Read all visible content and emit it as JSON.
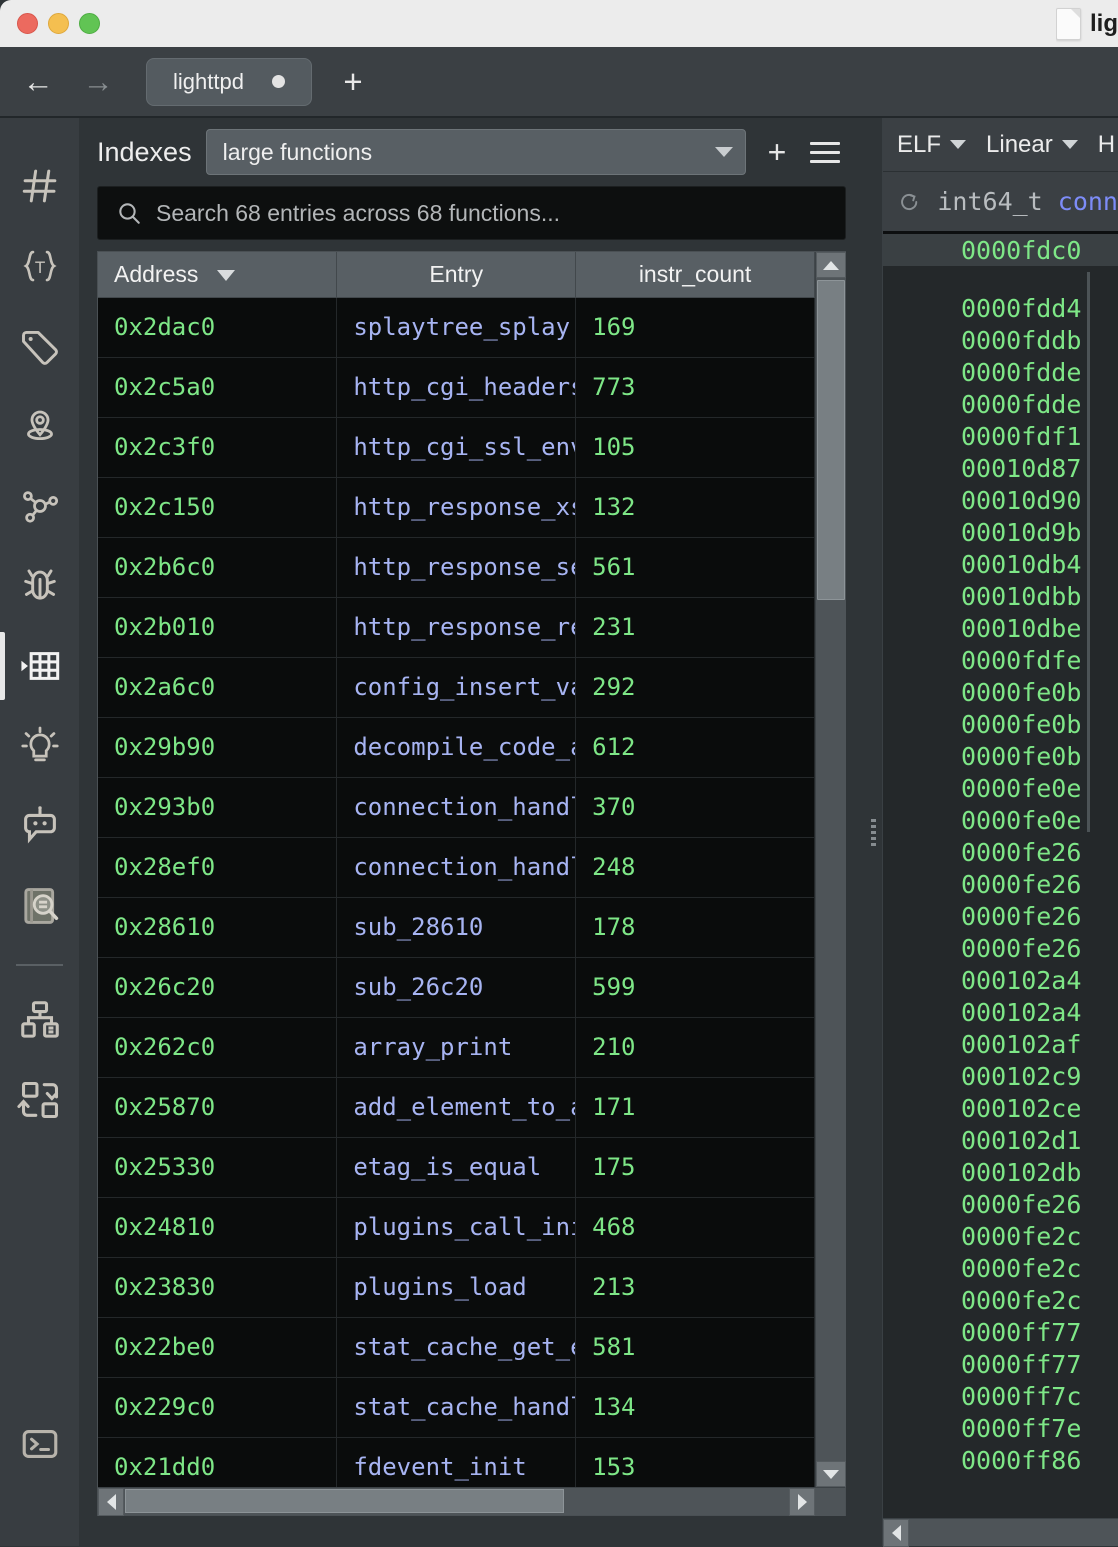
{
  "window": {
    "title": "lig",
    "doc_icon": "document-icon",
    "traffic_lights": [
      "close",
      "minimize",
      "maximize"
    ]
  },
  "tabbar": {
    "back_icon": "arrow-left-icon",
    "forward_icon": "arrow-right-icon",
    "new_tab_icon": "plus-icon",
    "tabs": [
      {
        "label": "lighttpd",
        "modified": true
      }
    ]
  },
  "sidebar": {
    "items": [
      {
        "name": "hash-icon",
        "label": "Symbols",
        "active": false
      },
      {
        "name": "types-icon",
        "label": "Types",
        "active": false
      },
      {
        "name": "tag-icon",
        "label": "Tags",
        "active": false
      },
      {
        "name": "location-pin-icon",
        "label": "Bookmarks",
        "active": false
      },
      {
        "name": "graph-nodes-icon",
        "label": "Call Graph",
        "active": false
      },
      {
        "name": "bug-icon",
        "label": "Debugger",
        "active": false
      },
      {
        "name": "table-grid-icon",
        "label": "Indexes",
        "active": true
      },
      {
        "name": "lightbulb-icon",
        "label": "Insights",
        "active": false
      },
      {
        "name": "robot-chat-icon",
        "label": "Assistant",
        "active": false
      },
      {
        "name": "notebook-search-icon",
        "label": "Notebook Search",
        "active": false
      },
      {
        "name": "hierarchy-icon",
        "label": "Hierarchy",
        "active": false
      },
      {
        "name": "cross-reference-icon",
        "label": "Cross References",
        "active": false
      }
    ],
    "bottom_item": {
      "name": "terminal-icon",
      "label": "Terminal"
    }
  },
  "indexes": {
    "title": "Indexes",
    "selected_index": "large functions",
    "add_label": "+",
    "menu_icon": "hamburger-menu-icon",
    "search": {
      "icon": "search-icon",
      "placeholder": "Search 68 entries across 68 functions...",
      "value": ""
    },
    "columns": [
      {
        "key": "address",
        "label": "Address",
        "sorted": "desc"
      },
      {
        "key": "entry",
        "label": "Entry",
        "sorted": "none"
      },
      {
        "key": "instr_count",
        "label": "instr_count",
        "sorted": "none"
      }
    ],
    "rows": [
      {
        "address": "0x2dac0",
        "entry": "splaytree_splay",
        "instr_count": "169"
      },
      {
        "address": "0x2c5a0",
        "entry": "http_cgi_headers",
        "instr_count": "773"
      },
      {
        "address": "0x2c3f0",
        "entry": "http_cgi_ssl_env",
        "instr_count": "105"
      },
      {
        "address": "0x2c150",
        "entry": "http_response_xsendfile",
        "instr_count": "132"
      },
      {
        "address": "0x2b6c0",
        "entry": "http_response_send_file",
        "instr_count": "561"
      },
      {
        "address": "0x2b010",
        "entry": "http_response_redirect_to_dir",
        "instr_count": "231"
      },
      {
        "address": "0x2a6c0",
        "entry": "config_insert_values_internal",
        "instr_count": "292"
      },
      {
        "address": "0x29b90",
        "entry": "decompile_code_analyze",
        "instr_count": "612"
      },
      {
        "address": "0x293b0",
        "entry": "connection_handle_read_post_state",
        "instr_count": "370"
      },
      {
        "address": "0x28ef0",
        "entry": "connection_handle_read",
        "instr_count": "248"
      },
      {
        "address": "0x28610",
        "entry": "sub_28610",
        "instr_count": "178"
      },
      {
        "address": "0x26c20",
        "entry": "sub_26c20",
        "instr_count": "599"
      },
      {
        "address": "0x262c0",
        "entry": "array_print",
        "instr_count": "210"
      },
      {
        "address": "0x25870",
        "entry": "add_element_to_array",
        "instr_count": "171"
      },
      {
        "address": "0x25330",
        "entry": "etag_is_equal",
        "instr_count": "175"
      },
      {
        "address": "0x24810",
        "entry": "plugins_call_init",
        "instr_count": "468"
      },
      {
        "address": "0x23830",
        "entry": "plugins_load",
        "instr_count": "213"
      },
      {
        "address": "0x22be0",
        "entry": "stat_cache_get_entry",
        "instr_count": "581"
      },
      {
        "address": "0x229c0",
        "entry": "stat_cache_handle_fdevent",
        "instr_count": "134"
      },
      {
        "address": "0x21dd0",
        "entry": "fdevent_init",
        "instr_count": "153"
      }
    ],
    "entry_count": 68,
    "function_count": 68
  },
  "disassembly": {
    "toolbar": [
      {
        "label": "ELF",
        "has_dropdown": true
      },
      {
        "label": "Linear",
        "has_dropdown": true
      },
      {
        "label": "H",
        "has_dropdown": false
      }
    ],
    "refresh_icon": "refresh-icon",
    "function_signature": {
      "return_type": "int64_t",
      "name": "conn"
    },
    "current_address": "0000fdc0",
    "addresses": [
      "0000fdd4",
      "0000fddb",
      "0000fdde",
      "0000fdde",
      "0000fdf1",
      "00010d87",
      "00010d90",
      "00010d9b",
      "00010db4",
      "00010dbb",
      "00010dbe",
      "0000fdfe",
      "0000fe0b",
      "0000fe0b",
      "0000fe0b",
      "0000fe0e",
      "0000fe0e",
      "0000fe26",
      "0000fe26",
      "0000fe26",
      "0000fe26",
      "000102a4",
      "000102a4",
      "000102af",
      "000102c9",
      "000102ce",
      "000102d1",
      "000102db",
      "0000fe26",
      "0000fe2c",
      "0000fe2c",
      "0000fe2c",
      "0000ff77",
      "0000ff77",
      "0000ff7c",
      "0000ff7e",
      "0000ff86"
    ]
  },
  "colors": {
    "address_green": "#7ee787",
    "entry_blue": "#a7b4f2",
    "panel_bg": "#2f3437",
    "table_bg": "#0a0c0c",
    "header_bg": "#585f64"
  }
}
